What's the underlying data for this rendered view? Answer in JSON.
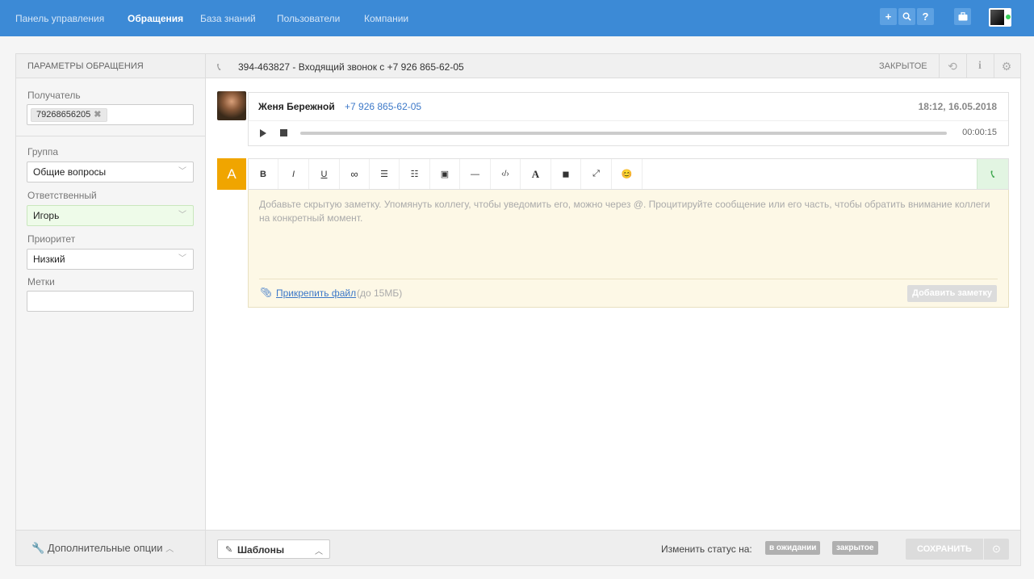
{
  "nav": {
    "items": [
      {
        "label": "Панель управления"
      },
      {
        "label": "Обращения"
      },
      {
        "label": "База знаний"
      },
      {
        "label": "Пользователи"
      },
      {
        "label": "Компании"
      }
    ],
    "active_index": 1,
    "icons": [
      "plus-icon",
      "search-icon",
      "help-icon",
      "briefcase-icon"
    ],
    "user_status_color": "#3ad15b",
    "bar_color": "#3c8ad6"
  },
  "sidebar": {
    "header": "ПАРАМЕТРЫ ОБРАЩЕНИЯ",
    "recipient_label": "Получатель",
    "recipient_tag": "79268656205",
    "group_label": "Группа",
    "group_value": "Общие вопросы",
    "assignee_label": "Ответственный",
    "assignee_value": "Игорь",
    "priority_label": "Приоритет",
    "priority_value": "Низкий",
    "tags_label": "Метки",
    "tags_value": "",
    "more_options": "Дополнительные опции"
  },
  "ticket": {
    "title": "394-463827 - Входящий звонок с +7 926 865-62-05",
    "status": "ЗАКРЫТОЕ"
  },
  "message": {
    "author": "Женя Бережной",
    "phone": "+7 926 865-62-05",
    "datetime": "18:12, 16.05.2018",
    "duration": "00:00:15"
  },
  "editor": {
    "badge": "A",
    "badge_color": "#f0a500",
    "toolbar": [
      {
        "label": "B",
        "icon": "bold-icon"
      },
      {
        "label": "I",
        "icon": "italic-icon"
      },
      {
        "label": "U",
        "icon": "underline-icon"
      },
      {
        "label": "∞",
        "icon": "link-icon"
      },
      {
        "label": "☰",
        "icon": "ordered-list-icon"
      },
      {
        "label": "☷",
        "icon": "bullet-list-icon"
      },
      {
        "label": "▣",
        "icon": "image-icon"
      },
      {
        "label": "—",
        "icon": "horizontal-rule-icon"
      },
      {
        "label": "‹/›",
        "icon": "code-icon"
      },
      {
        "label": "A",
        "icon": "text-color-icon"
      },
      {
        "label": "◼",
        "icon": "background-color-icon"
      },
      {
        "label": "⤢",
        "icon": "fullscreen-icon"
      },
      {
        "label": "😊",
        "icon": "emoji-icon"
      }
    ],
    "placeholder": "Добавьте скрытую заметку. Упомянуть коллегу, чтобы уведомить его, можно через @. Процитируйте сообщение или его часть, чтобы обратить внимание коллеги на конкретный момент.",
    "attach_label": "Прикрепить файл",
    "attach_limit": "(до 15МБ)",
    "add_note": "Добавить заметку"
  },
  "footer": {
    "templates": "Шаблоны",
    "change_status_label": "Изменить статус на:",
    "status_waiting": "в ожидании",
    "status_closed": "закрытое",
    "save": "СОХРАНИТЬ"
  }
}
